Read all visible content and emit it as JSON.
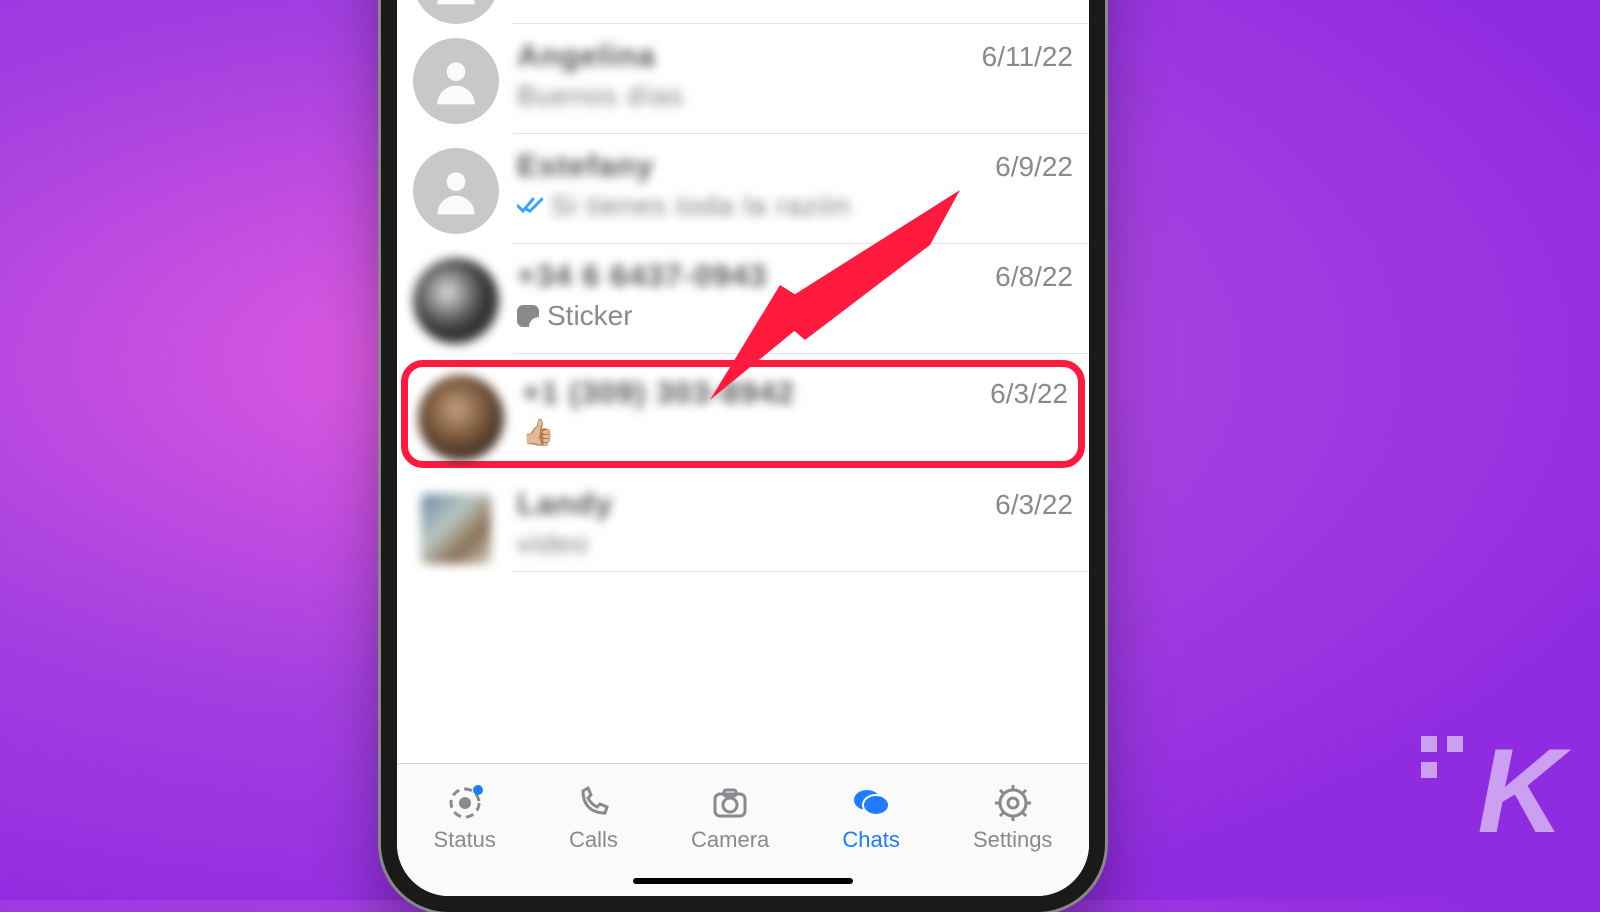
{
  "chats": [
    {
      "name": "Angelina",
      "preview": "Buenos días",
      "date": "6/11/22",
      "avatar": "placeholder"
    },
    {
      "name": "Estefany",
      "preview": "Si tienes toda la razón",
      "date": "6/9/22",
      "avatar": "placeholder",
      "read": true
    },
    {
      "name": "+34 6 6437-0943",
      "preview_kind": "sticker",
      "preview": "Sticker",
      "date": "6/8/22",
      "avatar": "photo1"
    },
    {
      "name": "+1 (309) 303-8942",
      "preview": "👍🏼",
      "date": "6/3/22",
      "avatar": "photo2",
      "highlighted": true
    },
    {
      "name": "Landy",
      "preview": "video",
      "date": "6/3/22",
      "avatar": "mini"
    }
  ],
  "tabs": {
    "status": "Status",
    "calls": "Calls",
    "camera": "Camera",
    "chats": "Chats",
    "settings": "Settings",
    "active": "chats"
  }
}
